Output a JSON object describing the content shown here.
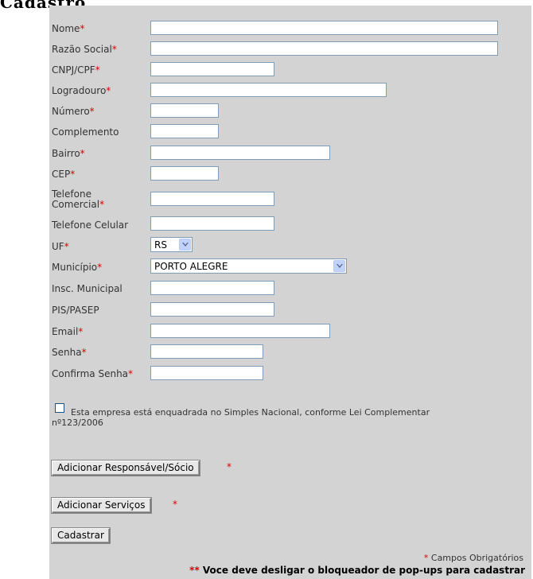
{
  "page_title": "Cadastro",
  "form": {
    "fields": [
      {
        "label": "Nome",
        "required": true,
        "type": "text",
        "value": ""
      },
      {
        "label": "Razão Social",
        "required": true,
        "type": "text",
        "value": ""
      },
      {
        "label": "CNPJ/CPF",
        "required": true,
        "type": "text",
        "value": ""
      },
      {
        "label": "Logradouro",
        "required": true,
        "type": "text",
        "value": ""
      },
      {
        "label": "Número",
        "required": true,
        "type": "text",
        "value": ""
      },
      {
        "label": "Complemento",
        "required": false,
        "type": "text",
        "value": ""
      },
      {
        "label": "Bairro",
        "required": true,
        "type": "text",
        "value": ""
      },
      {
        "label": "CEP",
        "required": true,
        "type": "text",
        "value": ""
      },
      {
        "label": "Telefone Comercial",
        "required": true,
        "type": "text",
        "value": ""
      },
      {
        "label": "Telefone Celular",
        "required": false,
        "type": "text",
        "value": ""
      },
      {
        "label": "UF",
        "required": true,
        "type": "select",
        "value": "RS"
      },
      {
        "label": "Município",
        "required": true,
        "type": "select",
        "value": "PORTO ALEGRE"
      },
      {
        "label": "Insc. Municipal",
        "required": false,
        "type": "text",
        "value": ""
      },
      {
        "label": "PIS/PASEP",
        "required": false,
        "type": "text",
        "value": ""
      },
      {
        "label": "Email",
        "required": true,
        "type": "text",
        "value": ""
      },
      {
        "label": "Senha",
        "required": true,
        "type": "password",
        "value": ""
      },
      {
        "label": "Confirma Senha",
        "required": true,
        "type": "password",
        "value": ""
      }
    ],
    "required_mark": "*",
    "simples_checkbox_label": "Esta empresa está enquadrada no Simples Nacional, conforme Lei Complementar nº123/2006",
    "simples_checked": false,
    "buttons": {
      "add_responsavel": "Adicionar Responsável/Sócio",
      "add_servicos": "Adicionar Serviços",
      "cadastrar": "Cadastrar"
    },
    "footer_required_note": "Campos Obrigatórios",
    "footer_popup_note": "Voce deve desligar o bloqueador de pop-ups para cadastrar",
    "footer_popup_mark": "**"
  },
  "colors": {
    "panel_bg": "#d3d3d3",
    "required": "#e00000",
    "input_border": "#7f9db9"
  }
}
